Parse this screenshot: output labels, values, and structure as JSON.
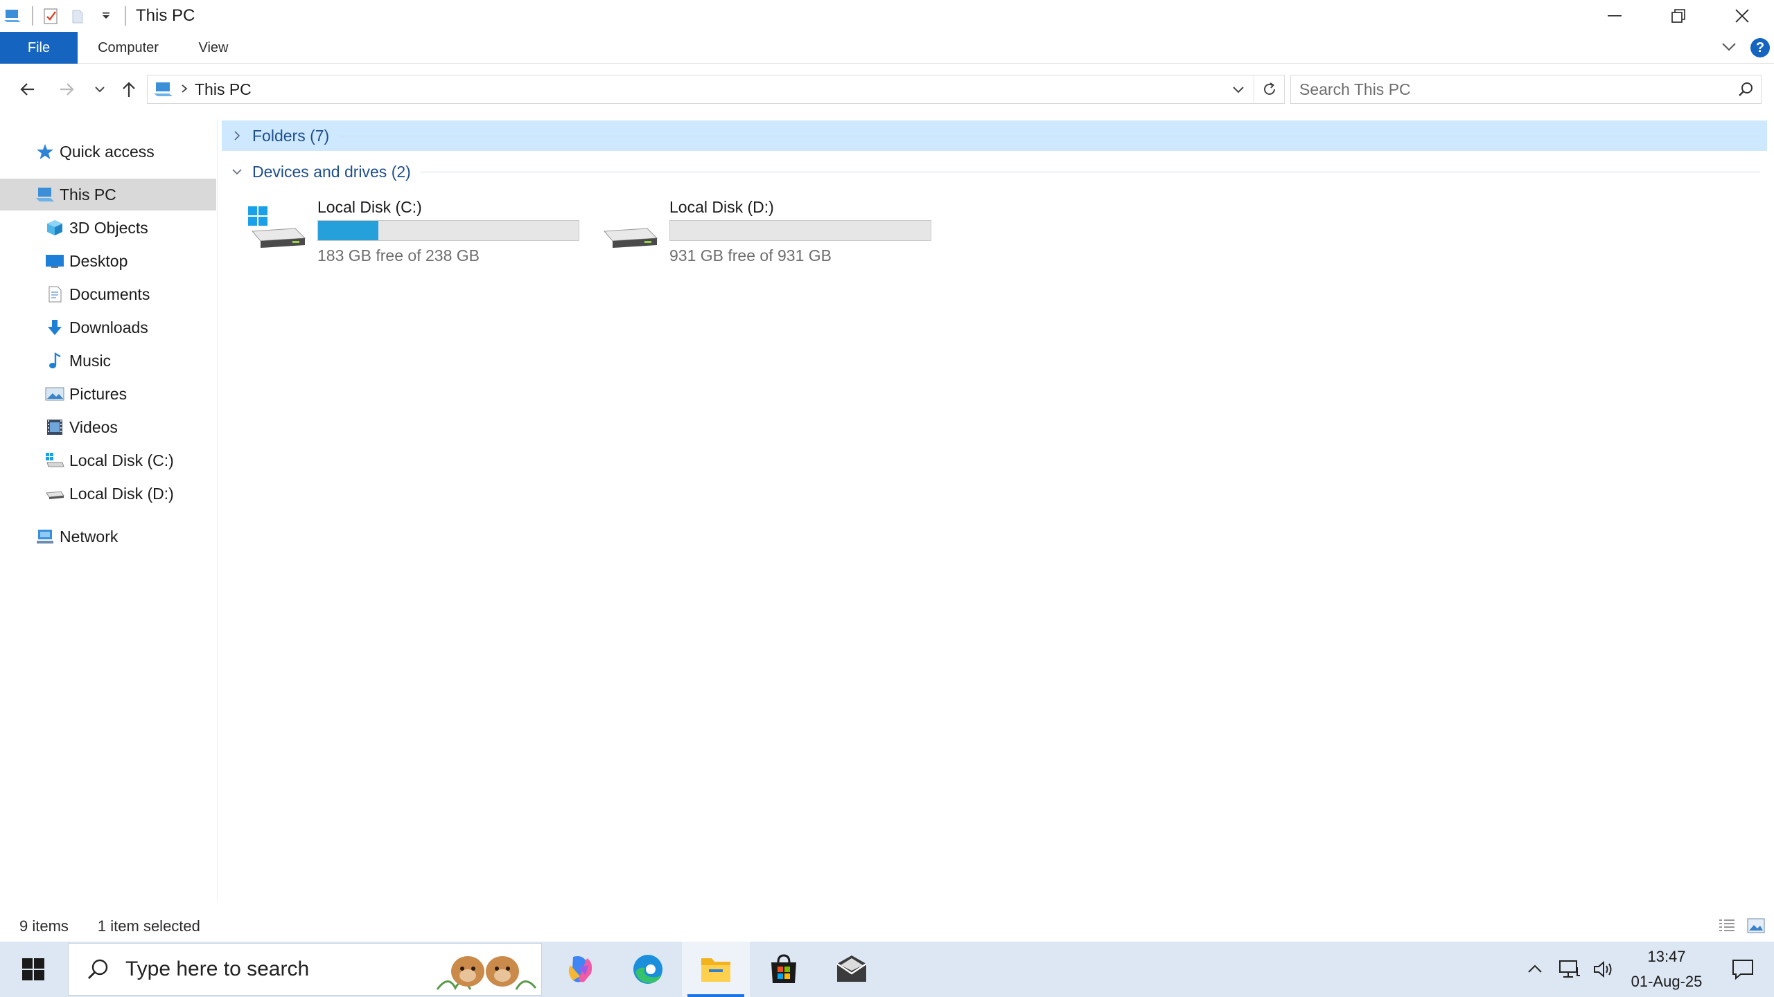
{
  "window": {
    "title": "This PC"
  },
  "ribbon": {
    "tabs": [
      {
        "label": "File"
      },
      {
        "label": "Computer"
      },
      {
        "label": "View"
      }
    ],
    "help": "?"
  },
  "address": {
    "crumb": "This PC",
    "search_placeholder": "Search This PC"
  },
  "nav": {
    "items": [
      {
        "label": "Quick access"
      },
      {
        "label": "This PC"
      },
      {
        "label": "3D Objects"
      },
      {
        "label": "Desktop"
      },
      {
        "label": "Documents"
      },
      {
        "label": "Downloads"
      },
      {
        "label": "Music"
      },
      {
        "label": "Pictures"
      },
      {
        "label": "Videos"
      },
      {
        "label": "Local Disk (C:)"
      },
      {
        "label": "Local Disk (D:)"
      },
      {
        "label": "Network"
      }
    ],
    "selected": "This PC"
  },
  "content": {
    "groups": [
      {
        "label": "Folders (7)",
        "expanded": false
      },
      {
        "label": "Devices and drives (2)",
        "expanded": true
      }
    ],
    "drives": [
      {
        "name": "Local Disk (C:)",
        "free_text": "183 GB free of 238 GB",
        "used_fraction": 0.231
      },
      {
        "name": "Local Disk (D:)",
        "free_text": "931 GB free of 931 GB",
        "used_fraction": 0.0
      }
    ]
  },
  "status": {
    "items_count": "9 items",
    "selection": "1 item selected"
  },
  "taskbar": {
    "search_placeholder": "Type here to search",
    "clock_time": "13:47",
    "clock_date": "01-Aug-25"
  },
  "colors": {
    "accent": "#1565c0",
    "drive_bar_fill": "#26a0da",
    "group_hover": "#cde8ff",
    "group_text": "#1e4e8c",
    "taskbar": "#dde7f3"
  }
}
